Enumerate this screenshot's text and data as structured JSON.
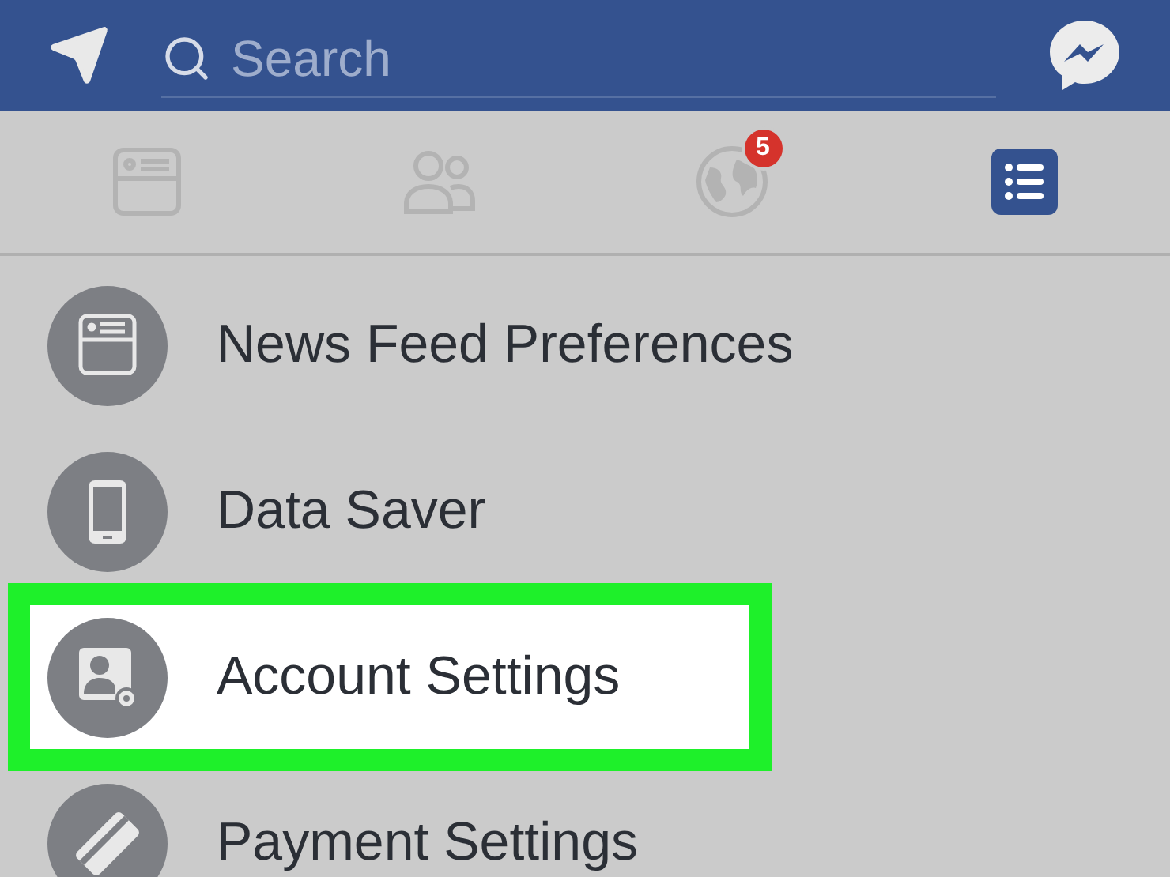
{
  "search": {
    "placeholder": "Search"
  },
  "tabs": [
    {
      "selected": false
    },
    {
      "selected": false
    },
    {
      "selected": false,
      "badge": "5"
    },
    {
      "selected": true
    }
  ],
  "menu": [
    {
      "label": "News Feed Preferences",
      "highlighted": false
    },
    {
      "label": "Data Saver",
      "highlighted": false
    },
    {
      "label": "Account Settings",
      "highlighted": true
    },
    {
      "label": "Payment Settings",
      "highlighted": false
    }
  ]
}
